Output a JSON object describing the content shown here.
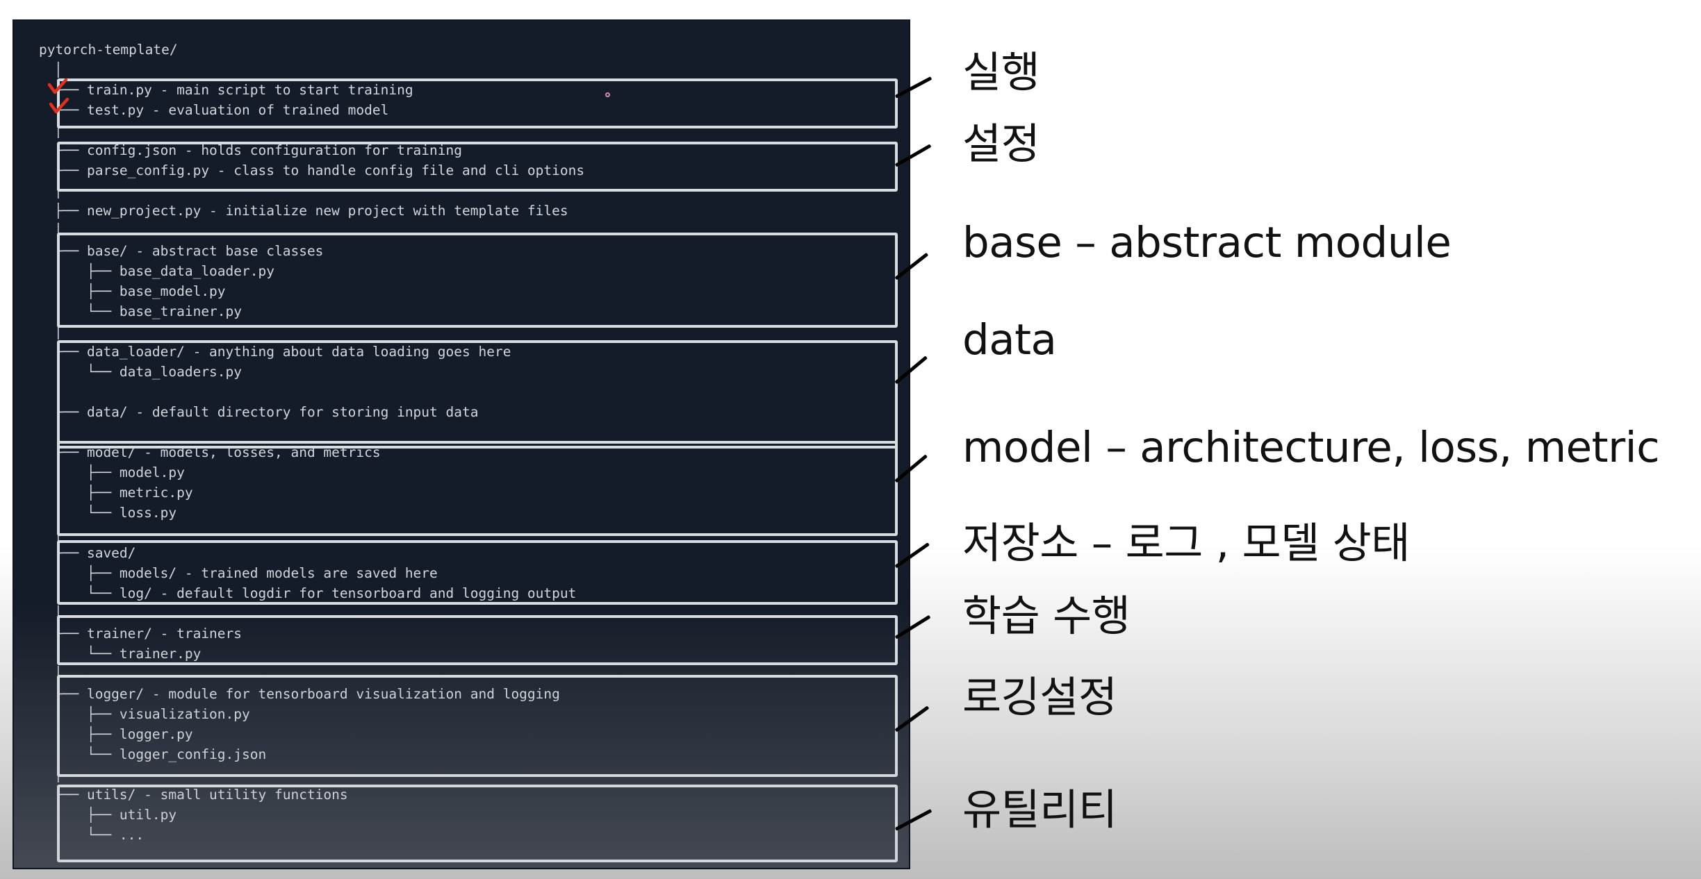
{
  "tree": {
    "root": "pytorch-template/",
    "lines": [
      "│",
      "├── train.py - main script to start training",
      "├── test.py - evaluation of trained model",
      "│",
      "├── config.json - holds configuration for training",
      "├── parse_config.py - class to handle config file and cli options",
      "│",
      "├── new_project.py - initialize new project with template files",
      "│",
      "├── base/ - abstract base classes",
      "│   ├── base_data_loader.py",
      "│   ├── base_model.py",
      "│   └── base_trainer.py",
      "│",
      "├── data_loader/ - anything about data loading goes here",
      "│   └── data_loaders.py",
      "│",
      "├── data/ - default directory for storing input data",
      "│",
      "├── model/ - models, losses, and metrics",
      "│   ├── model.py",
      "│   ├── metric.py",
      "│   └── loss.py",
      "│",
      "├── saved/",
      "│   ├── models/ - trained models are saved here",
      "│   └── log/ - default logdir for tensorboard and logging output",
      "│",
      "├── trainer/ - trainers",
      "│   └── trainer.py",
      "│",
      "├── logger/ - module for tensorboard visualization and logging",
      "│   ├── visualization.py",
      "│   ├── logger.py",
      "│   └── logger_config.json",
      "│",
      "└── utils/ - small utility functions",
      "    ├── util.py",
      "    └── ..."
    ]
  },
  "annotations": [
    "실행",
    "설정",
    "base – abstract module",
    "data",
    "model – architecture, loss, metric",
    "저장소 – 로그 , 모델 상태",
    "학습 수행",
    "로깅설정",
    "유틸리티"
  ],
  "colors": {
    "terminal_background": "#151c29",
    "terminal_text": "#d2d6dd",
    "group_box_border": "#d8dde2",
    "check_mark": "#e0301e",
    "annotation_text": "#111111"
  },
  "icons": [
    "check-mark-icon"
  ]
}
